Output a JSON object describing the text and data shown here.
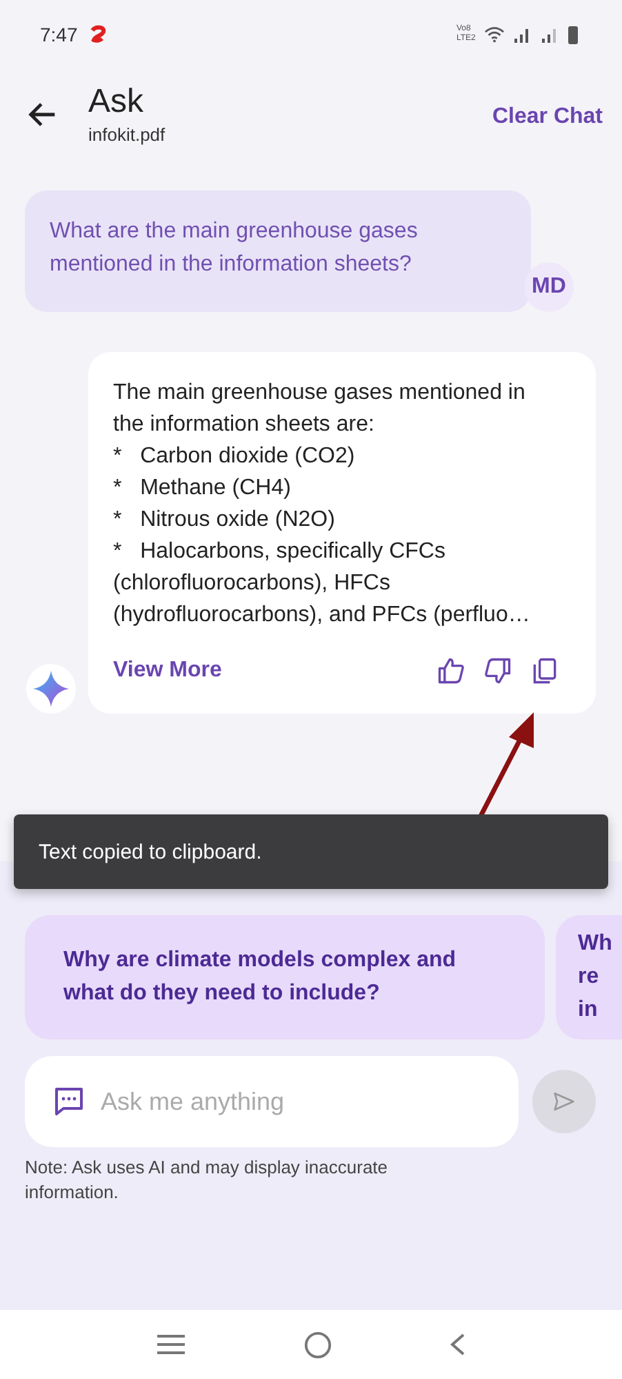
{
  "status_bar": {
    "time": "7:47",
    "network_label": "Vo8 LTE2"
  },
  "header": {
    "title": "Ask",
    "subtitle": "infokit.pdf",
    "action": "Clear Chat"
  },
  "messages": [
    {
      "kind": "user",
      "text": "What are the main greenhouse gases mentioned in the information sheets?",
      "avatar": "MD"
    },
    {
      "kind": "ai",
      "intro": "The main greenhouse gases mentioned in the information sheets are:",
      "bullets": [
        {
          "mark": "*",
          "text": "Carbon dioxide (CO2)"
        },
        {
          "mark": "*",
          "text": "Methane (CH4)"
        },
        {
          "mark": "*",
          "text": "Nitrous oxide (N2O)"
        },
        {
          "mark": "*",
          "text": "Halocarbons, specifically CFCs (chlorofluorocarbons), HFCs (hydrofluorocarbons), and PFCs (perfluo…"
        }
      ],
      "view_more": "View More"
    }
  ],
  "toast": {
    "text": "Text copied to clipboard."
  },
  "suggestions": [
    {
      "lines": [
        "Why are climate models complex and what do they need to include?"
      ]
    },
    {
      "lines": [
        "Wh",
        "re",
        "in"
      ]
    }
  ],
  "input": {
    "placeholder": "Ask me anything"
  },
  "note": "Note: Ask uses AI and may display inaccurate information."
}
